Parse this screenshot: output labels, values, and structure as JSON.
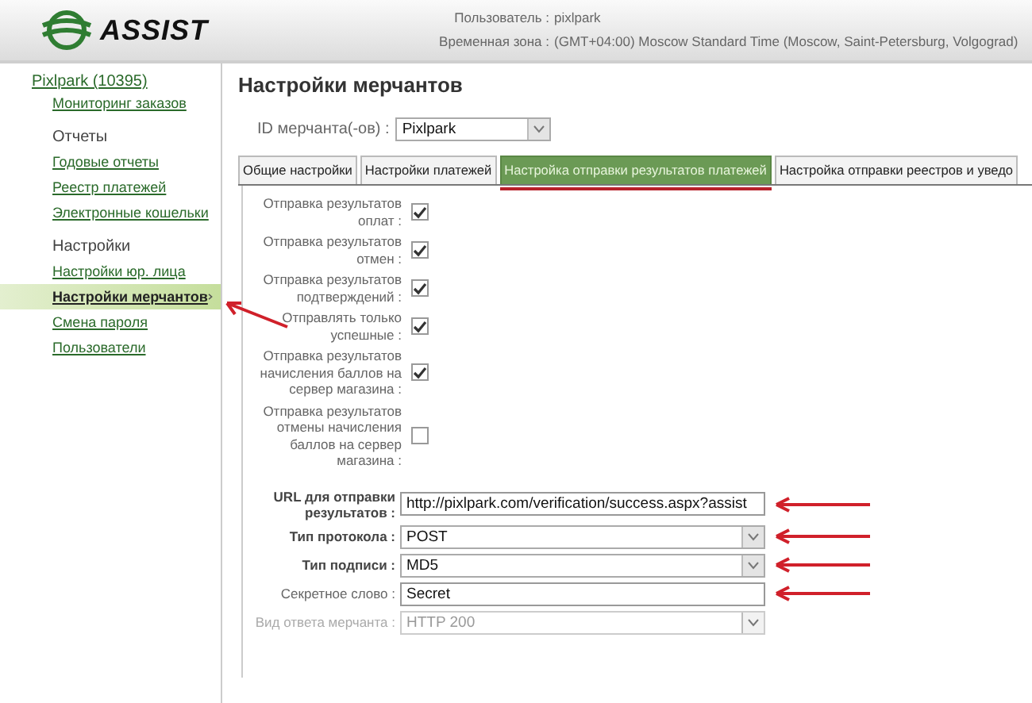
{
  "header": {
    "logo": "ASSIST",
    "user_label": "Пользователь :",
    "user": "pixlpark",
    "timezone_label": "Временная зона :",
    "timezone": "(GMT+04:00) Moscow Standard Time (Moscow, Saint-Petersburg, Volgograd)"
  },
  "sidebar": {
    "account": "Pixlpark (10395)",
    "groups": [
      {
        "items": [
          {
            "label": "Мониторинг заказов",
            "selected": false
          }
        ]
      },
      {
        "title": "Отчеты",
        "items": [
          {
            "label": "Годовые отчеты",
            "selected": false
          },
          {
            "label": "Реестр платежей",
            "selected": false
          },
          {
            "label": "Электронные кошельки",
            "selected": false
          }
        ]
      },
      {
        "title": "Настройки",
        "items": [
          {
            "label": "Настройки юр. лица",
            "selected": false
          },
          {
            "label": "Настройки мерчантов",
            "selected": true,
            "marked": true
          },
          {
            "label": "Смена пароля",
            "selected": false
          },
          {
            "label": "Пользователи",
            "selected": false
          }
        ]
      }
    ]
  },
  "page_title": "Настройки мерчантов",
  "merchant": {
    "label": "ID мерчанта(-ов) :",
    "value": "Pixlpark"
  },
  "tabs": [
    {
      "label": "Общие настройки",
      "selected": false
    },
    {
      "label": "Настройки платежей",
      "selected": false
    },
    {
      "label": "Настройка отправки результатов платежей",
      "selected": true,
      "marked": true
    },
    {
      "label": "Настройка отправки реестров и уведо",
      "selected": false
    }
  ],
  "checkboxes": [
    {
      "label": "Отправка результатов оплат :",
      "checked": true
    },
    {
      "label": "Отправка результатов отмен :",
      "checked": true
    },
    {
      "label": "Отправка результатов подтверждений :",
      "checked": true
    },
    {
      "label": "Отправлять только успешные :",
      "checked": true
    },
    {
      "label": "Отправка результатов начисления баллов на сервер магазина :",
      "checked": true
    },
    {
      "label": "Отправка результатов отмены начисления баллов на сервер магазина :",
      "checked": false
    }
  ],
  "fields": [
    {
      "kind": "text",
      "label": "URL для отправки результатов :",
      "value": "http://pixlpark.com/verification/success.aspx?assist",
      "bold": true,
      "disabled": false,
      "marked": true
    },
    {
      "kind": "select",
      "label": "Тип протокола :",
      "value": "POST",
      "bold": true,
      "disabled": false,
      "marked": true
    },
    {
      "kind": "select",
      "label": "Тип подписи :",
      "value": "MD5",
      "bold": true,
      "disabled": false,
      "marked": true
    },
    {
      "kind": "text",
      "label": "Секретное слово :",
      "value": "Secret",
      "bold": false,
      "disabled": false,
      "marked": true
    },
    {
      "kind": "select",
      "label": "Вид ответа мерчанта :",
      "value": "HTTP 200",
      "bold": false,
      "disabled": true
    }
  ]
}
